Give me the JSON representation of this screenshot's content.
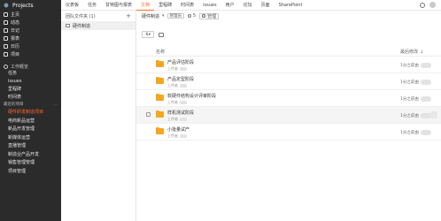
{
  "app": {
    "name": "Projects"
  },
  "sidebar": {
    "nav": [
      {
        "label": "主页",
        "icon": "home-icon"
      },
      {
        "label": "动态",
        "icon": "activity-icon"
      },
      {
        "label": "日记",
        "icon": "diary-icon"
      },
      {
        "label": "报表",
        "icon": "report-icon"
      },
      {
        "label": "日历",
        "icon": "calendar-icon"
      },
      {
        "label": "项目",
        "icon": "project-icon"
      }
    ],
    "workspace": {
      "title": "工作概览",
      "items": [
        "任务",
        "issues",
        "里程碑",
        "时间表"
      ]
    },
    "recent": {
      "title": "最近的项目",
      "more": "...",
      "items": [
        "硬件研发制造项目",
        "电商新品运营",
        "新品开发管理",
        "新媒体运营",
        "直播管理",
        "制造业产品开发",
        "销售管理管理",
        "项目管理"
      ],
      "active_index": 0
    }
  },
  "topbar": {
    "tabs": [
      "仪表板",
      "任务",
      "甘特图与报表",
      "文档",
      "里程碑",
      "时间表",
      "issues",
      "用户",
      "论坛",
      "页面",
      "SharePoint"
    ],
    "active_index": 3
  },
  "left_panel": {
    "title": "团队文件夹 (1)",
    "add": "+",
    "folder": "硬件制造"
  },
  "main": {
    "folder_name": "硬件制造",
    "admin_badge": "管理员",
    "member_count": "5",
    "manage_label": "管理",
    "list": {
      "col_name": "名称",
      "col_modified": "最后修改",
      "arrow": "↓"
    },
    "rows": [
      {
        "title": "产品评估阶段",
        "owner": "上传者",
        "time": "1分之前由"
      },
      {
        "title": "产品定型阶段",
        "owner": "上传者",
        "time": "1分之前由"
      },
      {
        "title": "软硬件结构设计评审阶段",
        "owner": "上传者",
        "time": "1分之前由"
      },
      {
        "title": "样机测试阶段",
        "owner": "上传者",
        "time": "1分之前由"
      },
      {
        "title": "小批量试产",
        "owner": "上传者",
        "time": "1分之前由"
      }
    ]
  },
  "colors": {
    "accent": "#ff6a2b",
    "sidebar_bg": "#2b2b2b",
    "folder": "#f6a623"
  }
}
